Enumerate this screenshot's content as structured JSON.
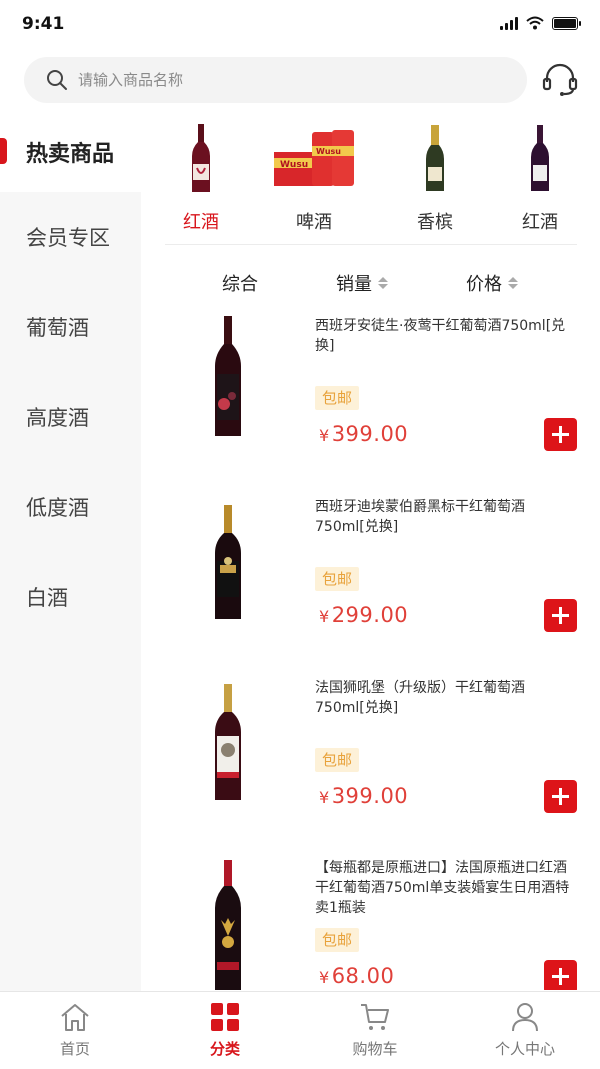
{
  "status": {
    "time": "9:41"
  },
  "search": {
    "placeholder": "请输入商品名称"
  },
  "sidebar": {
    "items": [
      {
        "label": "热卖商品",
        "active": true
      },
      {
        "label": "会员专区"
      },
      {
        "label": "葡萄酒"
      },
      {
        "label": "高度酒"
      },
      {
        "label": "低度酒"
      },
      {
        "label": "白酒"
      }
    ]
  },
  "categories": [
    {
      "label": "红酒",
      "active": true,
      "icon": "red-wine-bottle-icon"
    },
    {
      "label": "啤酒",
      "icon": "beer-pack-icon"
    },
    {
      "label": "香槟",
      "icon": "champagne-bottle-icon"
    },
    {
      "label": "红酒",
      "icon": "red-wine-bottle-icon"
    }
  ],
  "sort": {
    "comprehensive": "综合",
    "sales": "销量",
    "price": "价格"
  },
  "products": [
    {
      "name": "西班牙安徒生·夜莺干红葡萄酒750ml[兑换]",
      "tag": "包邮",
      "currency": "¥",
      "price": "399.00"
    },
    {
      "name": "西班牙迪埃蒙伯爵黑标干红葡萄酒750ml[兑换]",
      "tag": "包邮",
      "currency": "¥",
      "price": "299.00"
    },
    {
      "name": "法国狮吼堡（升级版）干红葡萄酒750ml[兑换]",
      "tag": "包邮",
      "currency": "¥",
      "price": "399.00"
    },
    {
      "name": "【每瓶都是原瓶进口】法国原瓶进口红酒干红葡萄酒750ml单支装婚宴生日用酒特卖1瓶装",
      "tag": "包邮",
      "currency": "¥",
      "price": "68.00"
    }
  ],
  "tabs": [
    {
      "label": "首页",
      "icon": "home-icon"
    },
    {
      "label": "分类",
      "icon": "category-grid-icon",
      "active": true
    },
    {
      "label": "购物车",
      "icon": "cart-icon"
    },
    {
      "label": "个人中心",
      "icon": "user-icon"
    }
  ],
  "colors": {
    "accent": "#d8161c",
    "price": "#e04039",
    "tag_bg": "#fdf1d8",
    "tag_text": "#e8a23b",
    "sidebar_bg": "#f7f7f7"
  }
}
